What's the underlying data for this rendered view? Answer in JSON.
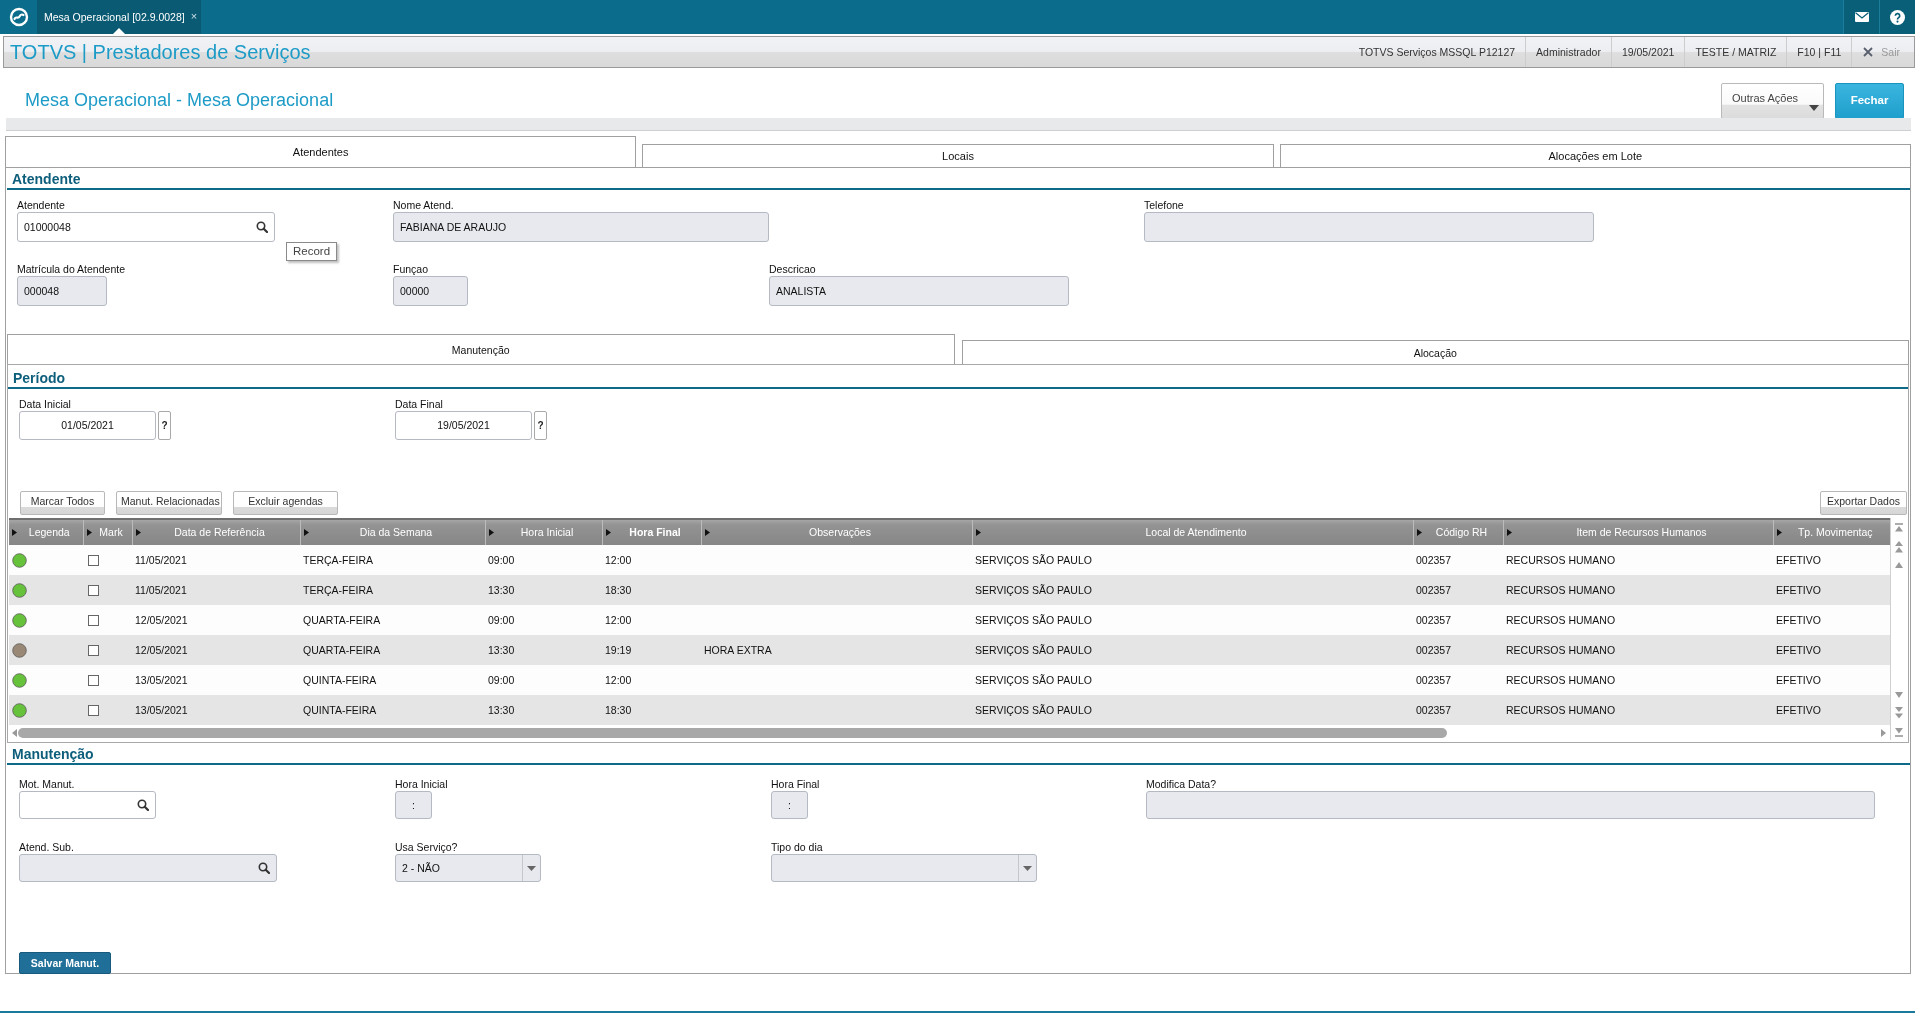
{
  "top_bar": {
    "tabs": [
      {
        "label": "Mesa Operacional [02.9.0028]",
        "close": "×",
        "selected": true
      }
    ]
  },
  "header": {
    "title": "TOTVS | Prestadores de Serviços",
    "info": [
      "TOTVS Serviços MSSQL P12127",
      "Administrador",
      "19/05/2021",
      "TESTE / MATRIZ",
      "F10 | F11"
    ],
    "exit": "Sair"
  },
  "page": {
    "title": "Mesa Operacional - Mesa Operacional",
    "actions": [
      {
        "label": "Outras Ações",
        "kind": "dropdown"
      },
      {
        "label": "Fechar",
        "kind": "primary"
      }
    ]
  },
  "tabs": [
    {
      "label": "Atendentes",
      "selected": true
    },
    {
      "label": "Locais",
      "selected": false
    },
    {
      "label": "Alocações em Lote",
      "selected": false
    }
  ],
  "atendente": {
    "title": "Atendente",
    "fields": [
      {
        "label": "Atendente",
        "kind": "lookup",
        "value": "01000048",
        "disabled": false,
        "tooltip": "Record"
      },
      {
        "label": "Nome Atend.",
        "kind": "text",
        "value": "FABIANA DE ARAUJO",
        "disabled": true
      },
      {
        "label": "Telefone",
        "kind": "text",
        "disabled": true
      },
      {
        "label": "Matrícula do Atendente",
        "kind": "text",
        "value": "000048",
        "disabled": true
      },
      {
        "label": "Funçao",
        "kind": "text",
        "value": "00000",
        "disabled": true
      },
      {
        "label": "Descricao",
        "kind": "text",
        "value": "ANALISTA",
        "disabled": true
      }
    ]
  },
  "subtabs": [
    {
      "label": "Manutenção",
      "selected": true
    },
    {
      "label": "Alocação",
      "selected": false
    }
  ],
  "periodo": {
    "title": "Período",
    "fields": [
      {
        "label": "Data Inicial",
        "kind": "date",
        "value": "01/05/2021",
        "help": "?",
        "disabled": false
      },
      {
        "label": "Data Final",
        "kind": "date",
        "value": "19/05/2021",
        "help": "?",
        "disabled": false
      }
    ]
  },
  "toolbar": {
    "buttons": [
      "Marcar Todos",
      "Manut. Relacionadas",
      "Excluir agendas"
    ],
    "export": "Exportar Dados"
  },
  "table": {
    "columns": [
      {
        "label": "Legenda",
        "sorted": false
      },
      {
        "label": "Mark",
        "sorted": false
      },
      {
        "label": "Data de Referência",
        "sorted": false
      },
      {
        "label": "Dia da Semana",
        "sorted": false
      },
      {
        "label": "Hora Inicial",
        "sorted": false
      },
      {
        "label": "Hora Final",
        "sorted": true
      },
      {
        "label": "Observações",
        "sorted": false
      },
      {
        "label": "Local de Atendimento",
        "sorted": false
      },
      {
        "label": "Código RH",
        "sorted": false
      },
      {
        "label": "Item de Recursos Humanos",
        "sorted": false
      },
      {
        "label": "Tp. Movimentaç",
        "sorted": false
      }
    ],
    "rows": [
      {
        "color": "#66c23a",
        "checked": false,
        "date": "11/05/2021",
        "weekday": "TERÇA-FEIRA",
        "start": "09:00",
        "end": "12:00",
        "location": "SERVIÇOS SÃO PAULO",
        "code": "002357",
        "item": "RECURSOS HUMANO",
        "type": "EFETIVO"
      },
      {
        "color": "#66c23a",
        "checked": false,
        "date": "11/05/2021",
        "weekday": "TERÇA-FEIRA",
        "start": "13:30",
        "end": "18:30",
        "location": "SERVIÇOS SÃO PAULO",
        "code": "002357",
        "item": "RECURSOS HUMANO",
        "type": "EFETIVO"
      },
      {
        "color": "#66c23a",
        "checked": false,
        "date": "12/05/2021",
        "weekday": "QUARTA-FEIRA",
        "start": "09:00",
        "end": "12:00",
        "location": "SERVIÇOS SÃO PAULO",
        "code": "002357",
        "item": "RECURSOS HUMANO",
        "type": "EFETIVO"
      },
      {
        "color": "#9a8876",
        "checked": false,
        "date": "12/05/2021",
        "weekday": "QUARTA-FEIRA",
        "start": "13:30",
        "end": "19:19",
        "note": "HORA EXTRA",
        "location": "SERVIÇOS SÃO PAULO",
        "code": "002357",
        "item": "RECURSOS HUMANO",
        "type": "EFETIVO"
      },
      {
        "color": "#66c23a",
        "checked": false,
        "date": "13/05/2021",
        "weekday": "QUINTA-FEIRA",
        "start": "09:00",
        "end": "12:00",
        "location": "SERVIÇOS SÃO PAULO",
        "code": "002357",
        "item": "RECURSOS HUMANO",
        "type": "EFETIVO"
      },
      {
        "color": "#66c23a",
        "checked": false,
        "date": "13/05/2021",
        "weekday": "QUINTA-FEIRA",
        "start": "13:30",
        "end": "18:30",
        "location": "SERVIÇOS SÃO PAULO",
        "code": "002357",
        "item": "RECURSOS HUMANO",
        "type": "EFETIVO"
      }
    ]
  },
  "manutencao": {
    "title": "Manutenção",
    "fields": [
      {
        "label": "Mot. Manut.",
        "kind": "lookup",
        "disabled": false
      },
      {
        "label": "Hora Inicial",
        "kind": "time",
        "value": ":",
        "disabled": true
      },
      {
        "label": "Hora Final",
        "kind": "time",
        "value": ":",
        "disabled": true
      },
      {
        "label": "Modifica Data?",
        "kind": "text",
        "disabled": true
      },
      {
        "label": "Atend. Sub.",
        "kind": "lookup",
        "disabled": true
      },
      {
        "label": "Usa Serviço?",
        "kind": "select",
        "value": "2 - NÃO",
        "disabled": true
      },
      {
        "label": "Tipo do dia",
        "kind": "select",
        "disabled": true
      }
    ]
  },
  "save_button": "Salvar Manut."
}
